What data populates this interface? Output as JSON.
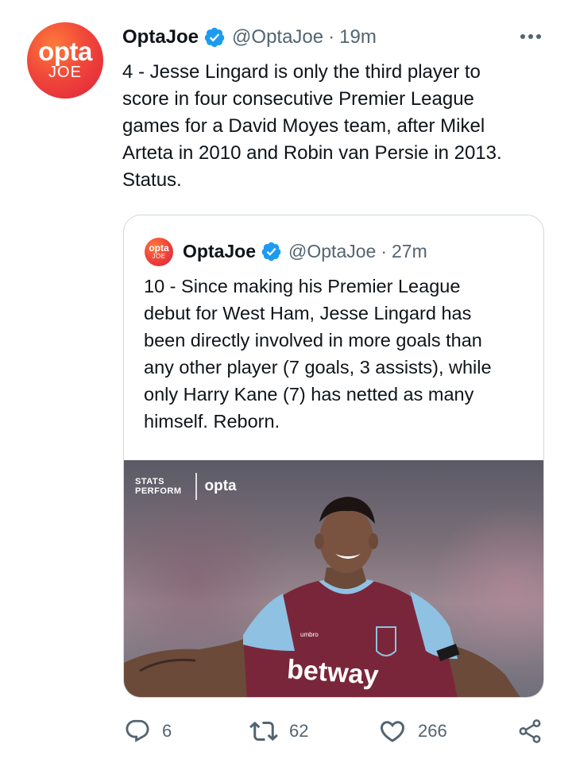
{
  "tweet": {
    "avatar": {
      "logo_top": "opta",
      "logo_bottom": "JOE"
    },
    "name": "OptaJoe",
    "handle": "@OptaJoe",
    "separator": "·",
    "time": "19m",
    "text": "4 - Jesse Lingard is only the third player to\nscore in four consecutive Premier League\ngames for a David Moyes team, after Mikel\nArteta in 2010 and Robin van Persie in 2013.\nStatus."
  },
  "quoted": {
    "avatar": {
      "logo_top": "opta",
      "logo_bottom": "JOE"
    },
    "name": "OptaJoe",
    "handle": "@OptaJoe",
    "separator": "·",
    "time": "27m",
    "text": "10 - Since making his Premier League\ndebut for West Ham, Jesse Lingard has\nbeen directly involved in more goals than\nany other player (7 goals, 3 assists), while\nonly Harry Kane (7) has netted as many\nhimself. Reborn.",
    "media": {
      "brand_stats": "STATS",
      "brand_perform": "PERFORM",
      "brand_opta": "opta",
      "shirt_sponsor": "betway"
    }
  },
  "actions": {
    "replies": "6",
    "retweets": "62",
    "likes": "266"
  },
  "icons": [
    "verified-icon",
    "more-icon",
    "reply-icon",
    "retweet-icon",
    "like-icon",
    "share-icon"
  ],
  "colors": {
    "verified_blue": "#1d9bf0",
    "text_secondary": "#536471",
    "opta_red": "#f0483a",
    "west_ham_claret": "#7a263a",
    "west_ham_blue": "#8fc1e3"
  }
}
